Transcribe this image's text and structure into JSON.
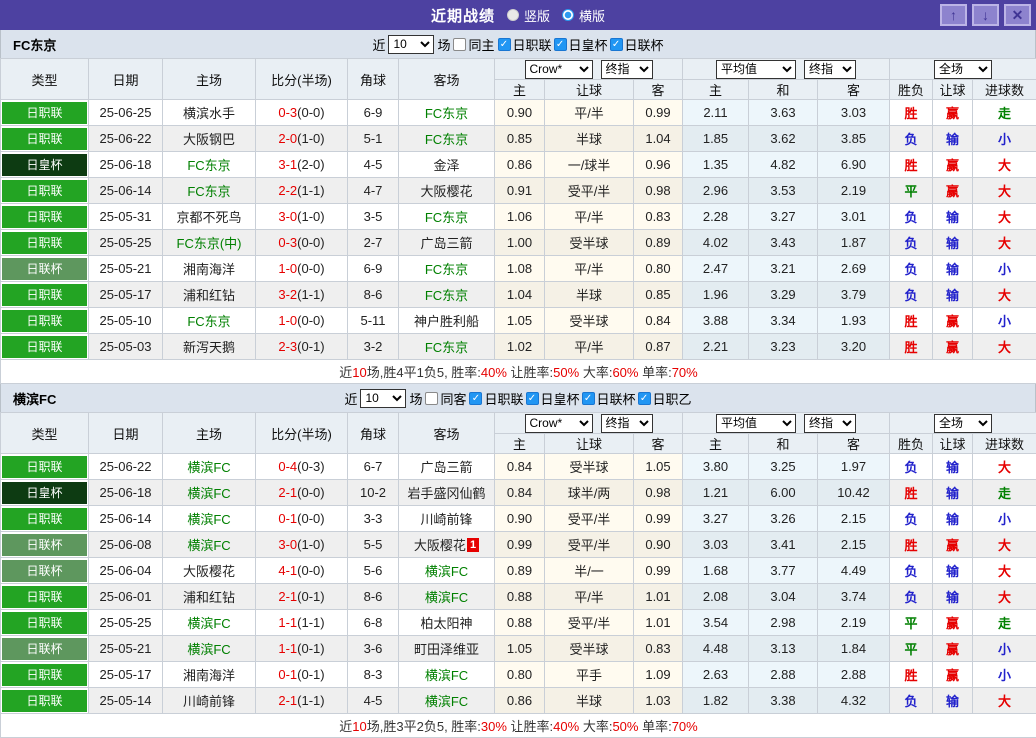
{
  "titlebar": {
    "title": "近期战绩",
    "modes": [
      {
        "label": "竖版",
        "selected": false
      },
      {
        "label": "横版",
        "selected": true
      }
    ],
    "buttons": {
      "up": "↑",
      "down": "↓",
      "close": "✕"
    }
  },
  "icons": {
    "check": "✓"
  },
  "colors": {
    "titlebar_purple": "#4D41A1",
    "j1_green": "#23A423",
    "emperor_cup_dark_green": "#0D3B12",
    "league_cup_green": "#5E975E",
    "win_red": "#E60000",
    "lose_blue": "#2222CC",
    "draw_green": "#008000",
    "focus_team_green": "#008000",
    "checkbox_blue": "#2196F3"
  },
  "header": {
    "left_cols": [
      "类型",
      "日期",
      "主场",
      "比分(半场)",
      "角球",
      "客场"
    ],
    "sub_cols": [
      "主",
      "让球",
      "客",
      "主",
      "和",
      "客",
      "胜负",
      "让球",
      "进球数"
    ]
  },
  "sections": [
    {
      "team": "FC东京",
      "filter": {
        "near": "近",
        "count": "10",
        "games": "场",
        "same": "同主",
        "same_checked": false,
        "leagues": [
          {
            "label": "日职联",
            "checked": true
          },
          {
            "label": "日皇杯",
            "checked": true
          },
          {
            "label": "日联杯",
            "checked": true
          }
        ]
      },
      "selects": {
        "odds": "Crow*",
        "odds_final": "终指",
        "avg": "平均值",
        "avg_final": "终指",
        "scope": "全场"
      },
      "rows": [
        {
          "type": "日职联",
          "date": "25-06-25",
          "home": "横滨水手",
          "home_focus": false,
          "score": "0-3",
          "half": "(0-0)",
          "corner": "6-9",
          "away": "FC东京",
          "away_focus": true,
          "away_badge": "",
          "odds": [
            "0.90",
            "平/半",
            "0.99"
          ],
          "avg": [
            "2.11",
            "3.63",
            "3.03"
          ],
          "results": [
            {
              "t": "胜",
              "c": "r"
            },
            {
              "t": "赢",
              "c": "r"
            },
            {
              "t": "走",
              "c": "g"
            }
          ]
        },
        {
          "type": "日职联",
          "date": "25-06-22",
          "home": "大阪钢巴",
          "home_focus": false,
          "score": "2-0",
          "half": "(1-0)",
          "corner": "5-1",
          "away": "FC东京",
          "away_focus": true,
          "away_badge": "",
          "odds": [
            "0.85",
            "半球",
            "1.04"
          ],
          "avg": [
            "1.85",
            "3.62",
            "3.85"
          ],
          "results": [
            {
              "t": "负",
              "c": "b"
            },
            {
              "t": "输",
              "c": "b"
            },
            {
              "t": "小",
              "c": "b"
            }
          ]
        },
        {
          "type": "日皇杯",
          "date": "25-06-18",
          "home": "FC东京",
          "home_focus": true,
          "score": "3-1",
          "half": "(2-0)",
          "corner": "4-5",
          "away": "金泽",
          "away_focus": false,
          "away_badge": "",
          "odds": [
            "0.86",
            "一/球半",
            "0.96"
          ],
          "avg": [
            "1.35",
            "4.82",
            "6.90"
          ],
          "results": [
            {
              "t": "胜",
              "c": "r"
            },
            {
              "t": "赢",
              "c": "r"
            },
            {
              "t": "大",
              "c": "r"
            }
          ]
        },
        {
          "type": "日职联",
          "date": "25-06-14",
          "home": "FC东京",
          "home_focus": true,
          "score": "2-2",
          "half": "(1-1)",
          "corner": "4-7",
          "away": "大阪樱花",
          "away_focus": false,
          "away_badge": "",
          "odds": [
            "0.91",
            "受平/半",
            "0.98"
          ],
          "avg": [
            "2.96",
            "3.53",
            "2.19"
          ],
          "results": [
            {
              "t": "平",
              "c": "g"
            },
            {
              "t": "赢",
              "c": "r"
            },
            {
              "t": "大",
              "c": "r"
            }
          ]
        },
        {
          "type": "日职联",
          "date": "25-05-31",
          "home": "京都不死鸟",
          "home_focus": false,
          "score": "3-0",
          "half": "(1-0)",
          "corner": "3-5",
          "away": "FC东京",
          "away_focus": true,
          "away_badge": "",
          "odds": [
            "1.06",
            "平/半",
            "0.83"
          ],
          "avg": [
            "2.28",
            "3.27",
            "3.01"
          ],
          "results": [
            {
              "t": "负",
              "c": "b"
            },
            {
              "t": "输",
              "c": "b"
            },
            {
              "t": "大",
              "c": "r"
            }
          ]
        },
        {
          "type": "日职联",
          "date": "25-05-25",
          "home": "FC东京(中)",
          "home_focus": true,
          "score": "0-3",
          "half": "(0-0)",
          "corner": "2-7",
          "away": "广岛三箭",
          "away_focus": false,
          "away_badge": "",
          "odds": [
            "1.00",
            "受半球",
            "0.89"
          ],
          "avg": [
            "4.02",
            "3.43",
            "1.87"
          ],
          "results": [
            {
              "t": "负",
              "c": "b"
            },
            {
              "t": "输",
              "c": "b"
            },
            {
              "t": "大",
              "c": "r"
            }
          ]
        },
        {
          "type": "日联杯",
          "date": "25-05-21",
          "home": "湘南海洋",
          "home_focus": false,
          "score": "1-0",
          "half": "(0-0)",
          "corner": "6-9",
          "away": "FC东京",
          "away_focus": true,
          "away_badge": "",
          "odds": [
            "1.08",
            "平/半",
            "0.80"
          ],
          "avg": [
            "2.47",
            "3.21",
            "2.69"
          ],
          "results": [
            {
              "t": "负",
              "c": "b"
            },
            {
              "t": "输",
              "c": "b"
            },
            {
              "t": "小",
              "c": "b"
            }
          ]
        },
        {
          "type": "日职联",
          "date": "25-05-17",
          "home": "浦和红钻",
          "home_focus": false,
          "score": "3-2",
          "half": "(1-1)",
          "corner": "8-6",
          "away": "FC东京",
          "away_focus": true,
          "away_badge": "",
          "odds": [
            "1.04",
            "半球",
            "0.85"
          ],
          "avg": [
            "1.96",
            "3.29",
            "3.79"
          ],
          "results": [
            {
              "t": "负",
              "c": "b"
            },
            {
              "t": "输",
              "c": "b"
            },
            {
              "t": "大",
              "c": "r"
            }
          ]
        },
        {
          "type": "日职联",
          "date": "25-05-10",
          "home": "FC东京",
          "home_focus": true,
          "score": "1-0",
          "half": "(0-0)",
          "corner": "5-11",
          "away": "神户胜利船",
          "away_focus": false,
          "away_badge": "",
          "odds": [
            "1.05",
            "受半球",
            "0.84"
          ],
          "avg": [
            "3.88",
            "3.34",
            "1.93"
          ],
          "results": [
            {
              "t": "胜",
              "c": "r"
            },
            {
              "t": "赢",
              "c": "r"
            },
            {
              "t": "小",
              "c": "b"
            }
          ]
        },
        {
          "type": "日职联",
          "date": "25-05-03",
          "home": "新泻天鹅",
          "home_focus": false,
          "score": "2-3",
          "half": "(0-1)",
          "corner": "3-2",
          "away": "FC东京",
          "away_focus": true,
          "away_badge": "",
          "odds": [
            "1.02",
            "平/半",
            "0.87"
          ],
          "avg": [
            "2.21",
            "3.23",
            "3.20"
          ],
          "results": [
            {
              "t": "胜",
              "c": "r"
            },
            {
              "t": "赢",
              "c": "r"
            },
            {
              "t": "大",
              "c": "r"
            }
          ]
        }
      ],
      "summary": [
        {
          "t": "近",
          "c": "k"
        },
        {
          "t": "10",
          "c": "r"
        },
        {
          "t": "场,胜4平1负5, 胜率:",
          "c": "k"
        },
        {
          "t": "40%",
          "c": "r"
        },
        {
          "t": " 让胜率:",
          "c": "k"
        },
        {
          "t": "50%",
          "c": "r"
        },
        {
          "t": " 大率:",
          "c": "k"
        },
        {
          "t": "60%",
          "c": "r"
        },
        {
          "t": " 单率:",
          "c": "k"
        },
        {
          "t": "70%",
          "c": "r"
        }
      ]
    },
    {
      "team": "横滨FC",
      "filter": {
        "near": "近",
        "count": "10",
        "games": "场",
        "same": "同客",
        "same_checked": false,
        "leagues": [
          {
            "label": "日职联",
            "checked": true
          },
          {
            "label": "日皇杯",
            "checked": true
          },
          {
            "label": "日联杯",
            "checked": true
          },
          {
            "label": "日职乙",
            "checked": true
          }
        ]
      },
      "selects": {
        "odds": "Crow*",
        "odds_final": "终指",
        "avg": "平均值",
        "avg_final": "终指",
        "scope": "全场"
      },
      "rows": [
        {
          "type": "日职联",
          "date": "25-06-22",
          "home": "横滨FC",
          "home_focus": true,
          "score": "0-4",
          "half": "(0-3)",
          "corner": "6-7",
          "away": "广岛三箭",
          "away_focus": false,
          "away_badge": "",
          "odds": [
            "0.84",
            "受半球",
            "1.05"
          ],
          "avg": [
            "3.80",
            "3.25",
            "1.97"
          ],
          "results": [
            {
              "t": "负",
              "c": "b"
            },
            {
              "t": "输",
              "c": "b"
            },
            {
              "t": "大",
              "c": "r"
            }
          ]
        },
        {
          "type": "日皇杯",
          "date": "25-06-18",
          "home": "横滨FC",
          "home_focus": true,
          "score": "2-1",
          "half": "(0-0)",
          "corner": "10-2",
          "away": "岩手盛冈仙鹤",
          "away_focus": false,
          "away_badge": "",
          "odds": [
            "0.84",
            "球半/两",
            "0.98"
          ],
          "avg": [
            "1.21",
            "6.00",
            "10.42"
          ],
          "results": [
            {
              "t": "胜",
              "c": "r"
            },
            {
              "t": "输",
              "c": "b"
            },
            {
              "t": "走",
              "c": "g"
            }
          ]
        },
        {
          "type": "日职联",
          "date": "25-06-14",
          "home": "横滨FC",
          "home_focus": true,
          "score": "0-1",
          "half": "(0-0)",
          "corner": "3-3",
          "away": "川崎前锋",
          "away_focus": false,
          "away_badge": "",
          "odds": [
            "0.90",
            "受平/半",
            "0.99"
          ],
          "avg": [
            "3.27",
            "3.26",
            "2.15"
          ],
          "results": [
            {
              "t": "负",
              "c": "b"
            },
            {
              "t": "输",
              "c": "b"
            },
            {
              "t": "小",
              "c": "b"
            }
          ]
        },
        {
          "type": "日联杯",
          "date": "25-06-08",
          "home": "横滨FC",
          "home_focus": true,
          "score": "3-0",
          "half": "(1-0)",
          "corner": "5-5",
          "away": "大阪樱花",
          "away_focus": false,
          "away_badge": "1",
          "odds": [
            "0.99",
            "受平/半",
            "0.90"
          ],
          "avg": [
            "3.03",
            "3.41",
            "2.15"
          ],
          "results": [
            {
              "t": "胜",
              "c": "r"
            },
            {
              "t": "赢",
              "c": "r"
            },
            {
              "t": "大",
              "c": "r"
            }
          ]
        },
        {
          "type": "日联杯",
          "date": "25-06-04",
          "home": "大阪樱花",
          "home_focus": false,
          "score": "4-1",
          "half": "(0-0)",
          "corner": "5-6",
          "away": "横滨FC",
          "away_focus": true,
          "away_badge": "",
          "odds": [
            "0.89",
            "半/一",
            "0.99"
          ],
          "avg": [
            "1.68",
            "3.77",
            "4.49"
          ],
          "results": [
            {
              "t": "负",
              "c": "b"
            },
            {
              "t": "输",
              "c": "b"
            },
            {
              "t": "大",
              "c": "r"
            }
          ]
        },
        {
          "type": "日职联",
          "date": "25-06-01",
          "home": "浦和红钻",
          "home_focus": false,
          "score": "2-1",
          "half": "(0-1)",
          "corner": "8-6",
          "away": "横滨FC",
          "away_focus": true,
          "away_badge": "",
          "odds": [
            "0.88",
            "平/半",
            "1.01"
          ],
          "avg": [
            "2.08",
            "3.04",
            "3.74"
          ],
          "results": [
            {
              "t": "负",
              "c": "b"
            },
            {
              "t": "输",
              "c": "b"
            },
            {
              "t": "大",
              "c": "r"
            }
          ]
        },
        {
          "type": "日职联",
          "date": "25-05-25",
          "home": "横滨FC",
          "home_focus": true,
          "score": "1-1",
          "half": "(1-1)",
          "corner": "6-8",
          "away": "柏太阳神",
          "away_focus": false,
          "away_badge": "",
          "odds": [
            "0.88",
            "受平/半",
            "1.01"
          ],
          "avg": [
            "3.54",
            "2.98",
            "2.19"
          ],
          "results": [
            {
              "t": "平",
              "c": "g"
            },
            {
              "t": "赢",
              "c": "r"
            },
            {
              "t": "走",
              "c": "g"
            }
          ]
        },
        {
          "type": "日联杯",
          "date": "25-05-21",
          "home": "横滨FC",
          "home_focus": true,
          "score": "1-1",
          "half": "(0-1)",
          "corner": "3-6",
          "away": "町田泽维亚",
          "away_focus": false,
          "away_badge": "",
          "odds": [
            "1.05",
            "受半球",
            "0.83"
          ],
          "avg": [
            "4.48",
            "3.13",
            "1.84"
          ],
          "results": [
            {
              "t": "平",
              "c": "g"
            },
            {
              "t": "赢",
              "c": "r"
            },
            {
              "t": "小",
              "c": "b"
            }
          ]
        },
        {
          "type": "日职联",
          "date": "25-05-17",
          "home": "湘南海洋",
          "home_focus": false,
          "score": "0-1",
          "half": "(0-1)",
          "corner": "8-3",
          "away": "横滨FC",
          "away_focus": true,
          "away_badge": "",
          "odds": [
            "0.80",
            "平手",
            "1.09"
          ],
          "avg": [
            "2.63",
            "2.88",
            "2.88"
          ],
          "results": [
            {
              "t": "胜",
              "c": "r"
            },
            {
              "t": "赢",
              "c": "r"
            },
            {
              "t": "小",
              "c": "b"
            }
          ]
        },
        {
          "type": "日职联",
          "date": "25-05-14",
          "home": "川崎前锋",
          "home_focus": false,
          "score": "2-1",
          "half": "(1-1)",
          "corner": "4-5",
          "away": "横滨FC",
          "away_focus": true,
          "away_badge": "",
          "odds": [
            "0.86",
            "半球",
            "1.03"
          ],
          "avg": [
            "1.82",
            "3.38",
            "4.32"
          ],
          "results": [
            {
              "t": "负",
              "c": "b"
            },
            {
              "t": "输",
              "c": "b"
            },
            {
              "t": "大",
              "c": "r"
            }
          ]
        }
      ],
      "summary": [
        {
          "t": "近",
          "c": "k"
        },
        {
          "t": "10",
          "c": "r"
        },
        {
          "t": "场,胜3平2负5, 胜率:",
          "c": "k"
        },
        {
          "t": "30%",
          "c": "r"
        },
        {
          "t": " 让胜率:",
          "c": "k"
        },
        {
          "t": "40%",
          "c": "r"
        },
        {
          "t": " 大率:",
          "c": "k"
        },
        {
          "t": "50%",
          "c": "r"
        },
        {
          "t": " 单率:",
          "c": "k"
        },
        {
          "t": "70%",
          "c": "r"
        }
      ]
    }
  ]
}
